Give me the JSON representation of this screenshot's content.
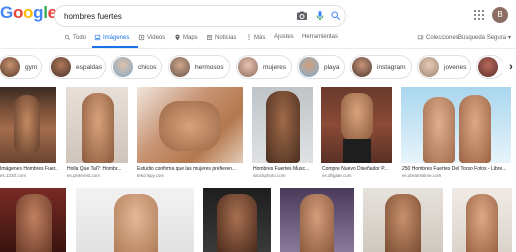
{
  "search": {
    "query": "hombres fuertes"
  },
  "logo": {
    "letters": [
      "G",
      "o",
      "o",
      "g",
      "l",
      "e"
    ],
    "colors": [
      "#4285f4",
      "#ea4335",
      "#fbbc05",
      "#4285f4",
      "#34a853",
      "#ea4335"
    ]
  },
  "account": {
    "initial": "B"
  },
  "tabs": {
    "todo": "Todo",
    "imagenes": "Imágenes",
    "videos": "Videos",
    "maps": "Maps",
    "noticias": "Noticias",
    "mas": "Más",
    "ajustes": "Ajustes",
    "herramientas": "Herramientas",
    "colecciones": "Colecciones",
    "busqueda_segura": "Búsqueda Segura"
  },
  "chips": [
    "gym",
    "espaldas",
    "chicos",
    "hermosos",
    "mujeres",
    "playa",
    "instagram",
    "jovenes"
  ],
  "results": [
    {
      "caption": "Imágenes Hombres Fuer...",
      "source": "es.123rf.com"
    },
    {
      "caption": "Holla Que Tal?: Hombr...",
      "source": "es.pinterest.com"
    },
    {
      "caption": "Estudio confirma que las mujeres prefieren...",
      "source": "tekcrispy.com"
    },
    {
      "caption": "Hombres Fuertes Musc...",
      "source": "istockphoto.com"
    },
    {
      "caption": "Compre Nuevo Diseñador P...",
      "source": "es.dhgate.com"
    },
    {
      "caption": "250 Hombres Fuertes Del Torso Fotos - Libre...",
      "source": "es.dreamstime.com"
    }
  ],
  "colors": {
    "accent": "#1a73e8",
    "skin_light": "#d9a27c",
    "skin_dark": "#8a5a3c"
  }
}
